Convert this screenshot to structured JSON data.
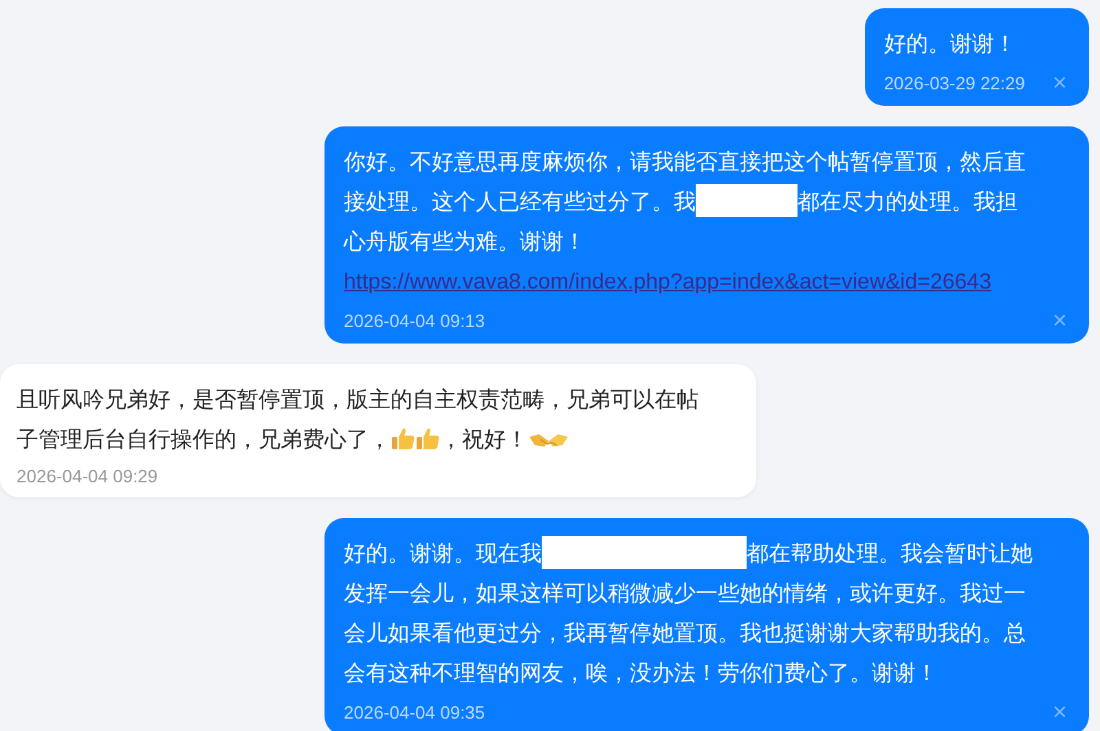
{
  "messages": [
    {
      "kind": "sent",
      "parts": [
        {
          "kind": "text",
          "text": "好的。谢谢！"
        }
      ],
      "time": "2026-03-29 22:29",
      "close": "×"
    },
    {
      "kind": "sent",
      "parts": [
        {
          "kind": "text",
          "text": "你好。不好意思再度麻烦你，请我能否直接把这个帖暂停置顶，然后直接处理。这个人已经有些过分了。我"
        },
        {
          "kind": "blank"
        },
        {
          "kind": "text",
          "text": "都在尽力的处理。我担心舟版有些为难。谢谢！"
        },
        {
          "kind": "link",
          "text": "https://www.vava8.com/index.php?app=index&act=view&id=26643"
        }
      ],
      "time": "2026-04-04 09:13",
      "close": "×"
    },
    {
      "kind": "received",
      "parts": [
        {
          "kind": "text",
          "text": "且听风吟兄弟好，是否暂停置顶，版主的自主权责范畴，兄弟可以在帖子管理后台自行操作的，兄弟费心了，"
        },
        {
          "kind": "thumbs"
        },
        {
          "kind": "thumbs"
        },
        {
          "kind": "text",
          "text": "，祝好！"
        },
        {
          "kind": "handshake"
        }
      ],
      "time": "2026-04-04 09:29"
    },
    {
      "kind": "sent",
      "parts": [
        {
          "kind": "text",
          "text": "好的。谢谢。现在我"
        },
        {
          "kind": "longblank"
        },
        {
          "kind": "text",
          "text": "都在帮助处理。我会暂时让她发挥一会儿，如果这样可以稍微减少一些她的情绪，或许更好。我过一会儿如果看他更过分，我再暂停她置顶。我也挺谢谢大家帮助我的。总会有这种不理智的网友，唉，没办法！劳你们费心了。谢谢！"
        }
      ],
      "time": "2026-04-04 09:35",
      "close": "×"
    }
  ]
}
